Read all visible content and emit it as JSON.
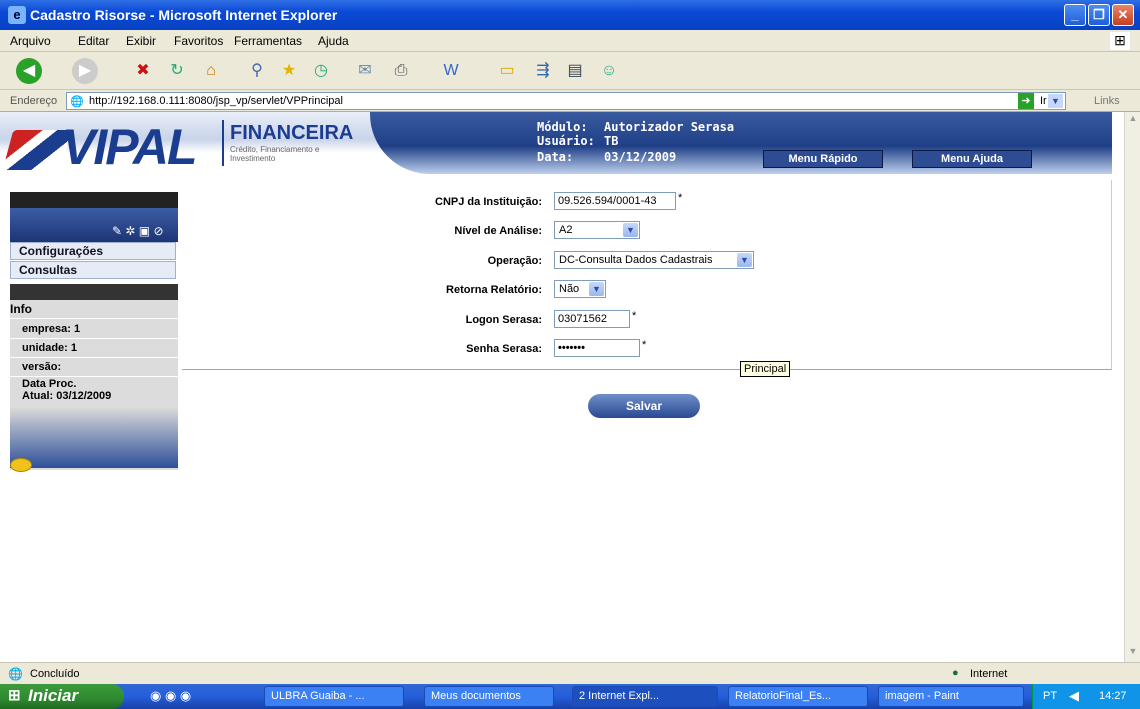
{
  "window": {
    "title": "Cadastro Risorse - Microsoft Internet Explorer"
  },
  "menu": [
    "Arquivo",
    "Editar",
    "Exibir",
    "Favoritos",
    "Ferramentas",
    "Ajuda"
  ],
  "address": {
    "label": "Endereço",
    "url": "http://192.168.0.111:8080/jsp_vp/servlet/VPPrincipal",
    "go": "Ir",
    "links": "Links"
  },
  "header": {
    "brand": "VIPAL",
    "division": "FINANCEIRA",
    "division_sub": "Crédito, Financiamento e Investimento",
    "modulo_label": "Módulo:",
    "modulo_value": "Autorizador Serasa",
    "usuario_label": "Usuário:",
    "usuario_value": "TB",
    "data_label": "Data:",
    "data_value": "03/12/2009",
    "menu_rapido": "Menu Rápido",
    "menu_ajuda": "Menu Ajuda"
  },
  "sidebar": {
    "items": [
      "Configurações",
      "Consultas"
    ],
    "info_title": "Info",
    "info": [
      "empresa: 1",
      "unidade: 1",
      "versão:",
      "Data Proc."
    ],
    "info_date": "Atual: 03/12/2009"
  },
  "form": {
    "cnpj_label": "CNPJ da Instituição:",
    "cnpj_value": "09.526.594/0001-43",
    "nivel_label": "Nível de Análise:",
    "nivel_value": "A2",
    "operacao_label": "Operação:",
    "operacao_value": "DC-Consulta Dados Cadastrais",
    "retorna_label": "Retorna Relatório:",
    "retorna_value": "Não",
    "logon_label": "Logon Serasa:",
    "logon_value": "03071562",
    "senha_label": "Senha Serasa:",
    "senha_value": "•••••••",
    "required": "*",
    "tooltip": "Principal",
    "save": "Salvar"
  },
  "status": {
    "text": "Concluído",
    "zone": "Internet"
  },
  "taskbar": {
    "start": "Iniciar",
    "tasks": [
      "ULBRA Guaiba - ...",
      "Meus documentos",
      "2 Internet Expl...",
      "RelatorioFinal_Es...",
      "imagem - Paint"
    ],
    "lang": "PT",
    "clock": "14:27"
  }
}
